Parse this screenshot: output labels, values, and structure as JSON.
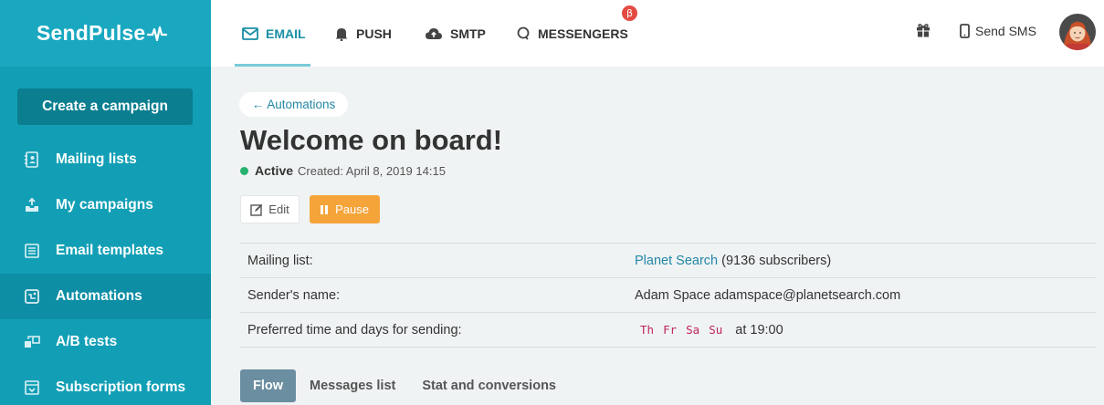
{
  "logo": {
    "text": "SendPulse"
  },
  "sidebar": {
    "create_label": "Create a campaign",
    "items": [
      {
        "label": "Mailing lists",
        "icon": "contacts-book-icon"
      },
      {
        "label": "My campaigns",
        "icon": "send-upload-icon"
      },
      {
        "label": "Email templates",
        "icon": "template-icon"
      },
      {
        "label": "Automations",
        "icon": "automation-icon",
        "active": true
      },
      {
        "label": "A/B tests",
        "icon": "ab-test-icon"
      },
      {
        "label": "Subscription forms",
        "icon": "form-icon"
      }
    ]
  },
  "topbar": {
    "tabs": [
      {
        "label": "EMAIL",
        "icon": "envelope-icon",
        "active": true
      },
      {
        "label": "PUSH",
        "icon": "bell-icon"
      },
      {
        "label": "SMTP",
        "icon": "cloud-upload-icon"
      },
      {
        "label": "MESSENGERS",
        "icon": "chat-icon"
      }
    ],
    "beta_badge": "β",
    "send_sms_label": "Send SMS",
    "colors": {
      "accent": "#1a8fa5",
      "beta": "#e44a42"
    }
  },
  "main": {
    "back_label": "← Automations",
    "title": "Welcome on board!",
    "status": "Active",
    "created": "Created: April 8, 2019 14:15",
    "edit_label": "Edit",
    "pause_label": "Pause",
    "info": {
      "mailing_list_label": "Mailing list:",
      "mailing_list_name": "Planet Search",
      "mailing_list_count": " (9136 subscribers)",
      "sender_label": "Sender's name:",
      "sender_value": "Adam Space adamspace@planetsearch.com",
      "pref_label": "Preferred time and days for sending:",
      "days": [
        "Th",
        "Fr",
        "Sa",
        "Su"
      ],
      "time": "at 19:00"
    },
    "subtabs": [
      {
        "label": "Flow",
        "active": true
      },
      {
        "label": "Messages list"
      },
      {
        "label": "Stat and conversions"
      }
    ]
  }
}
